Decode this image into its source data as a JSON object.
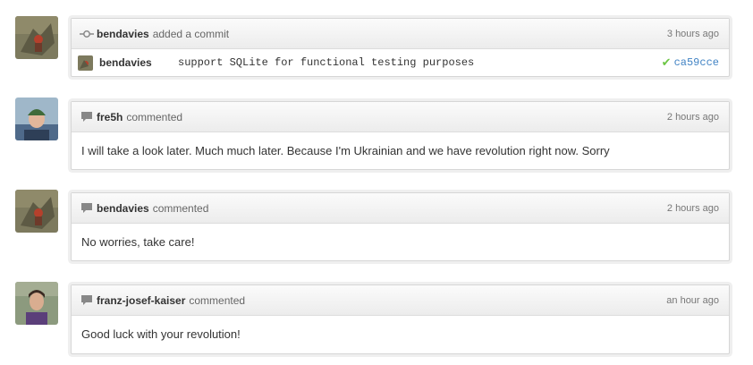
{
  "colors": {
    "link": "#4183c4",
    "check": "#6cc644"
  },
  "commit_event": {
    "actor": "bendavies",
    "action": "added a commit",
    "time": "3 hours ago",
    "commit_author": "bendavies",
    "message": "support SQLite for functional testing purposes",
    "sha": "ca59cce",
    "icon": "commit-icon",
    "status_icon": "check-icon"
  },
  "comments": [
    {
      "author": "fre5h",
      "action": "commented",
      "time": "2 hours ago",
      "body": "I will take a look later. Much much later. Because I'm Ukrainian and we have revolution right now. Sorry",
      "icon": "comment-icon"
    },
    {
      "author": "bendavies",
      "action": "commented",
      "time": "2 hours ago",
      "body": "No worries, take care!",
      "icon": "comment-icon"
    },
    {
      "author": "franz-josef-kaiser",
      "action": "commented",
      "time": "an hour ago",
      "body": "Good luck with your revolution!",
      "icon": "comment-icon"
    }
  ]
}
